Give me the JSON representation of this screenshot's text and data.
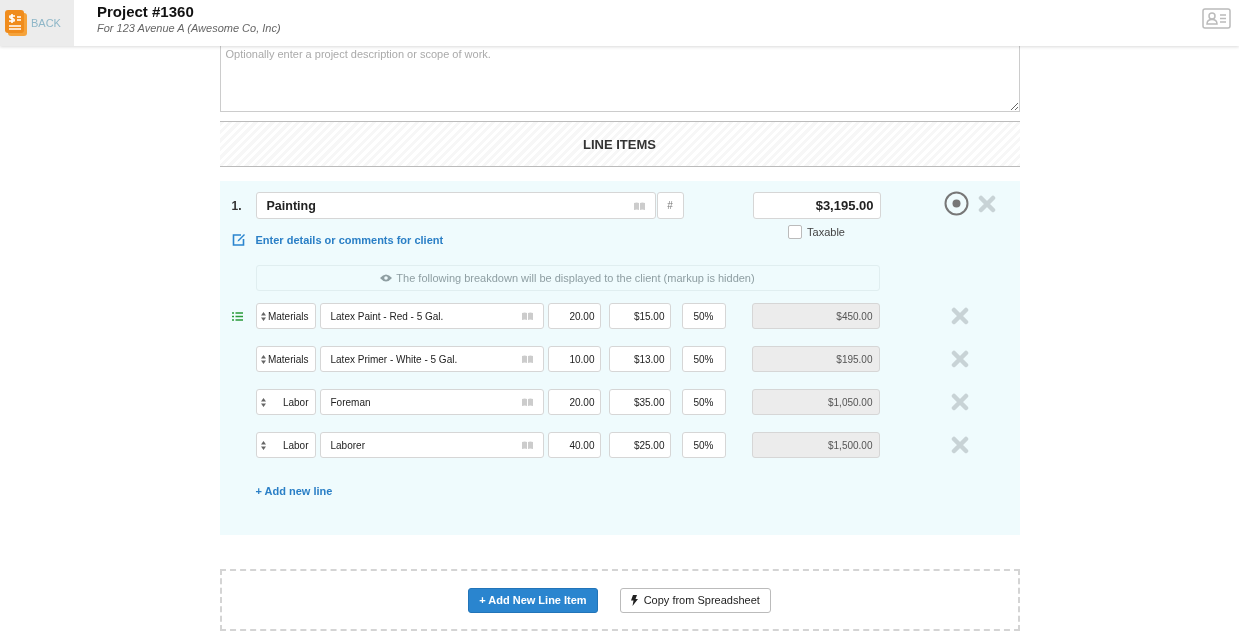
{
  "header": {
    "back_label": "BACK",
    "title": "Project #1360",
    "subtitle": "For 123 Avenue A (Awesome Co, Inc)"
  },
  "description": {
    "placeholder": "Optionally enter a project description or scope of work."
  },
  "section_title": "LINE ITEMS",
  "items": [
    {
      "number": "1.",
      "name": "Painting",
      "hash_label": "#",
      "total": "$3,195.00",
      "taxable": {
        "label": "Taxable",
        "checked": false
      },
      "details_link": "Enter details or comments for client",
      "breakdown_note": "The following breakdown will be displayed to the client (markup is hidden)",
      "lines": [
        {
          "type": "Materials",
          "description": "Latex Paint - Red - 5 Gal.",
          "quantity": "20.00",
          "rate": "$15.00",
          "markup": "50%",
          "amount": "$450.00"
        },
        {
          "type": "Materials",
          "description": "Latex Primer - White - 5 Gal.",
          "quantity": "10.00",
          "rate": "$13.00",
          "markup": "50%",
          "amount": "$195.00"
        },
        {
          "type": "Labor",
          "description": "Foreman",
          "quantity": "20.00",
          "rate": "$35.00",
          "markup": "50%",
          "amount": "$1,050.00"
        },
        {
          "type": "Labor",
          "description": "Laborer",
          "quantity": "40.00",
          "rate": "$25.00",
          "markup": "50%",
          "amount": "$1,500.00"
        }
      ],
      "add_line": "+ Add new line"
    }
  ],
  "actions": {
    "add_item": "+ Add New Line Item",
    "copy": "Copy from Spreadsheet"
  }
}
